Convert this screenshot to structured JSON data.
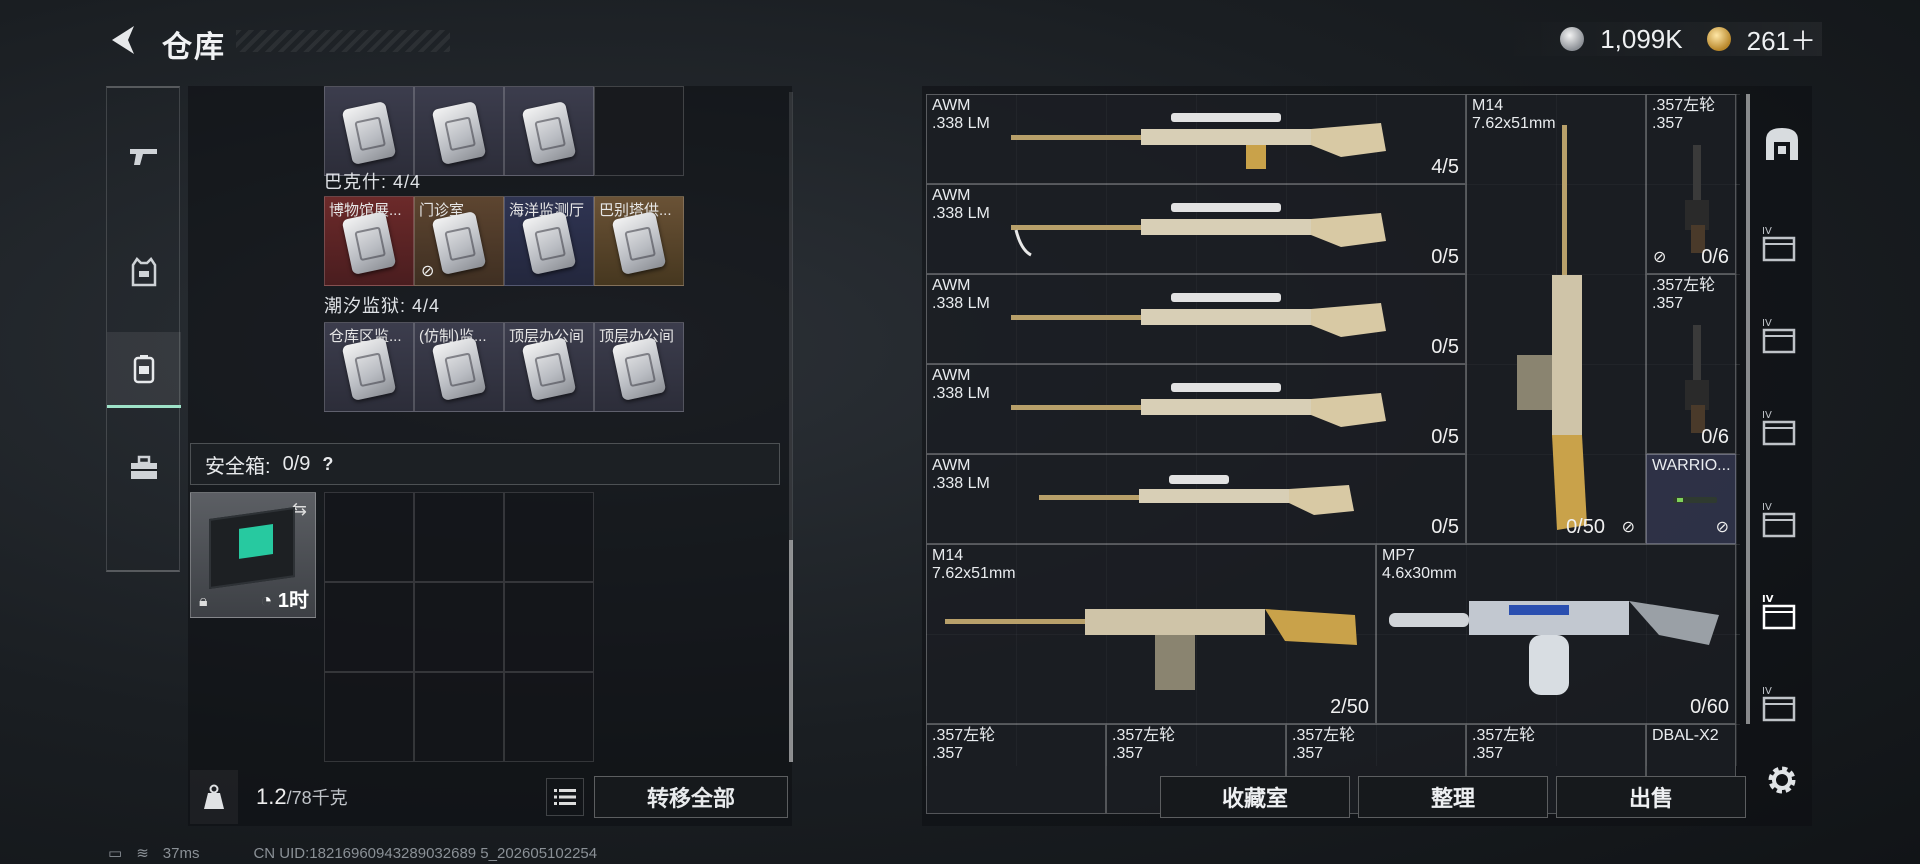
{
  "header": {
    "title": "仓库",
    "currency_1": "1,099K",
    "currency_2": "261＋"
  },
  "left_nav": {
    "items": [
      "weapons",
      "armor",
      "backpack",
      "tools"
    ],
    "active": "backpack"
  },
  "backpack": {
    "row1_cells": [
      {
        "label": ""
      },
      {
        "label": ""
      },
      {
        "label": ""
      },
      {
        "label": ""
      }
    ],
    "section_1": "巴克什: 4/4",
    "row2_cells": [
      {
        "label": "博物馆展...",
        "color": "red"
      },
      {
        "label": "门诊室",
        "color": "brown"
      },
      {
        "label": "海洋监测厅",
        "color": "navy"
      },
      {
        "label": "巴别塔供...",
        "color": "tan"
      }
    ],
    "section_2": "潮汐监狱: 4/4",
    "row3_cells": [
      {
        "label": "仓库区监..."
      },
      {
        "label": "(仿制)监..."
      },
      {
        "label": "顶层办公间"
      },
      {
        "label": "顶层办公间"
      }
    ],
    "safe_box_label": "安全箱:",
    "safe_box_count": "0/9",
    "safe_box_help": "?",
    "safe_item_timer": "1时",
    "weight_value": "1.2",
    "weight_max": "/78千克",
    "transfer_all": "转移全部"
  },
  "status": {
    "ping": "37ms",
    "uid": "CN UID:18216960943289032689 5_202605102254"
  },
  "stash": {
    "items": [
      {
        "name": "AWM\n.338 LM",
        "count": "4/5"
      },
      {
        "name": "AWM\n.338 LM",
        "count": "0/5"
      },
      {
        "name": "AWM\n.338 LM",
        "count": "0/5"
      },
      {
        "name": "AWM\n.338 LM",
        "count": "0/5"
      },
      {
        "name": "AWM\n.338 LM",
        "count": "0/5"
      },
      {
        "name": "M14\n7.62x51mm",
        "count": "0/50"
      },
      {
        "name": ".357左轮\n.357",
        "count": "0/6"
      },
      {
        "name": ".357左轮\n.357",
        "count": "0/6"
      },
      {
        "name": "WARRIO...",
        "count": ""
      },
      {
        "name": "M14\n7.62x51mm",
        "count": "2/50"
      },
      {
        "name": "MP7\n4.6x30mm",
        "count": "0/60"
      },
      {
        "name": ".357左轮\n.357",
        "count": ""
      },
      {
        "name": ".357左轮\n.357",
        "count": ""
      },
      {
        "name": ".357左轮\n.357",
        "count": ""
      },
      {
        "name": ".357左轮\n.357",
        "count": ""
      },
      {
        "name": "DBAL-X2",
        "count": ""
      }
    ],
    "buttons": {
      "collection": "收藏室",
      "sort": "整理",
      "sell": "出售"
    }
  },
  "colors": {
    "accent": "#9ee2c8",
    "gold_skin": "#c9a24a",
    "bg": "#1a1e22"
  }
}
